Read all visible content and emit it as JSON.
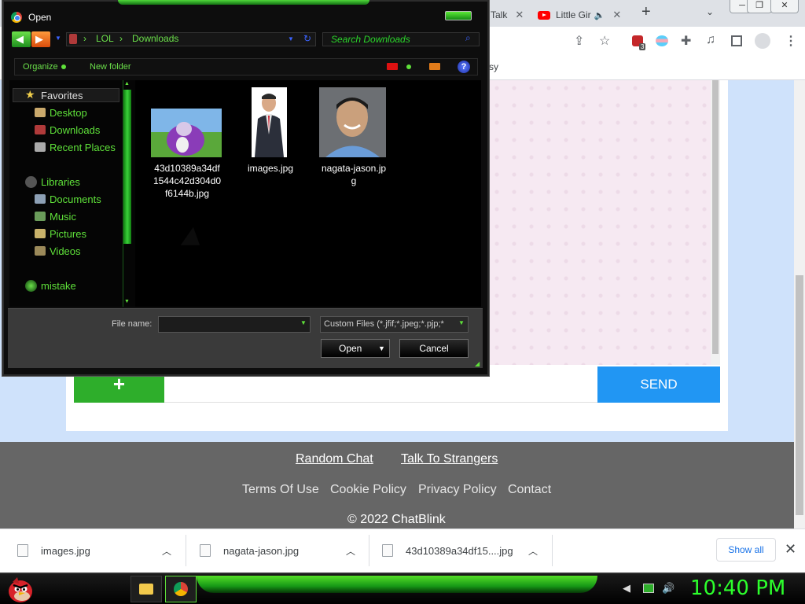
{
  "browser": {
    "tabs": [
      {
        "label": "Talk",
        "close": "✕"
      },
      {
        "label": "Little Gir",
        "close": "✕"
      }
    ],
    "new_tab": "+",
    "tab_dropdown": "⌄",
    "window_buttons": [
      "─",
      "❐",
      "✕"
    ],
    "extension_badge": "3",
    "bookmark_fragment": "sy"
  },
  "page": {
    "plus_button": "+",
    "send_button": "SEND",
    "footer": {
      "links_row1": [
        "Random Chat",
        "Talk To Strangers"
      ],
      "links_row2": [
        "Terms Of Use",
        "Cookie Policy",
        "Privacy Policy",
        "Contact"
      ],
      "copyright": "© 2022 ChatBlink"
    }
  },
  "downloads": {
    "items": [
      "images.jpg",
      "nagata-jason.jpg",
      "43d10389a34df15....jpg"
    ],
    "show_all": "Show all",
    "close": "✕"
  },
  "dialog": {
    "title": "Open",
    "address": {
      "segments": [
        "LOL",
        "Downloads"
      ]
    },
    "search_placeholder": "Search Downloads",
    "commands": {
      "organize": "Organize",
      "new_folder": "New folder",
      "help": "?"
    },
    "nav": {
      "favorites": "Favorites",
      "favorite_items": [
        "Desktop",
        "Downloads",
        "Recent Places"
      ],
      "libraries": "Libraries",
      "library_items": [
        "Documents",
        "Music",
        "Pictures",
        "Videos"
      ],
      "other": "mistake"
    },
    "files": [
      {
        "name_lines": [
          "43d10389a34df",
          "1544c42d304d0",
          "f6144b.jpg"
        ]
      },
      {
        "name_lines": [
          "images.jpg"
        ]
      },
      {
        "name_lines": [
          "nagata-jason.jp",
          "g"
        ]
      }
    ],
    "file_name_label": "File name:",
    "file_name_value": "",
    "file_type": "Custom Files (*.jfif;*.jpeg;*.pjp;*",
    "open_button": "Open",
    "cancel_button": "Cancel"
  },
  "taskbar": {
    "clock": "10:40 PM"
  },
  "colors": {
    "accent_green": "#5fe13a",
    "send_blue": "#2196f3",
    "plus_green": "#2eae2b",
    "footer_gray": "#666666"
  }
}
